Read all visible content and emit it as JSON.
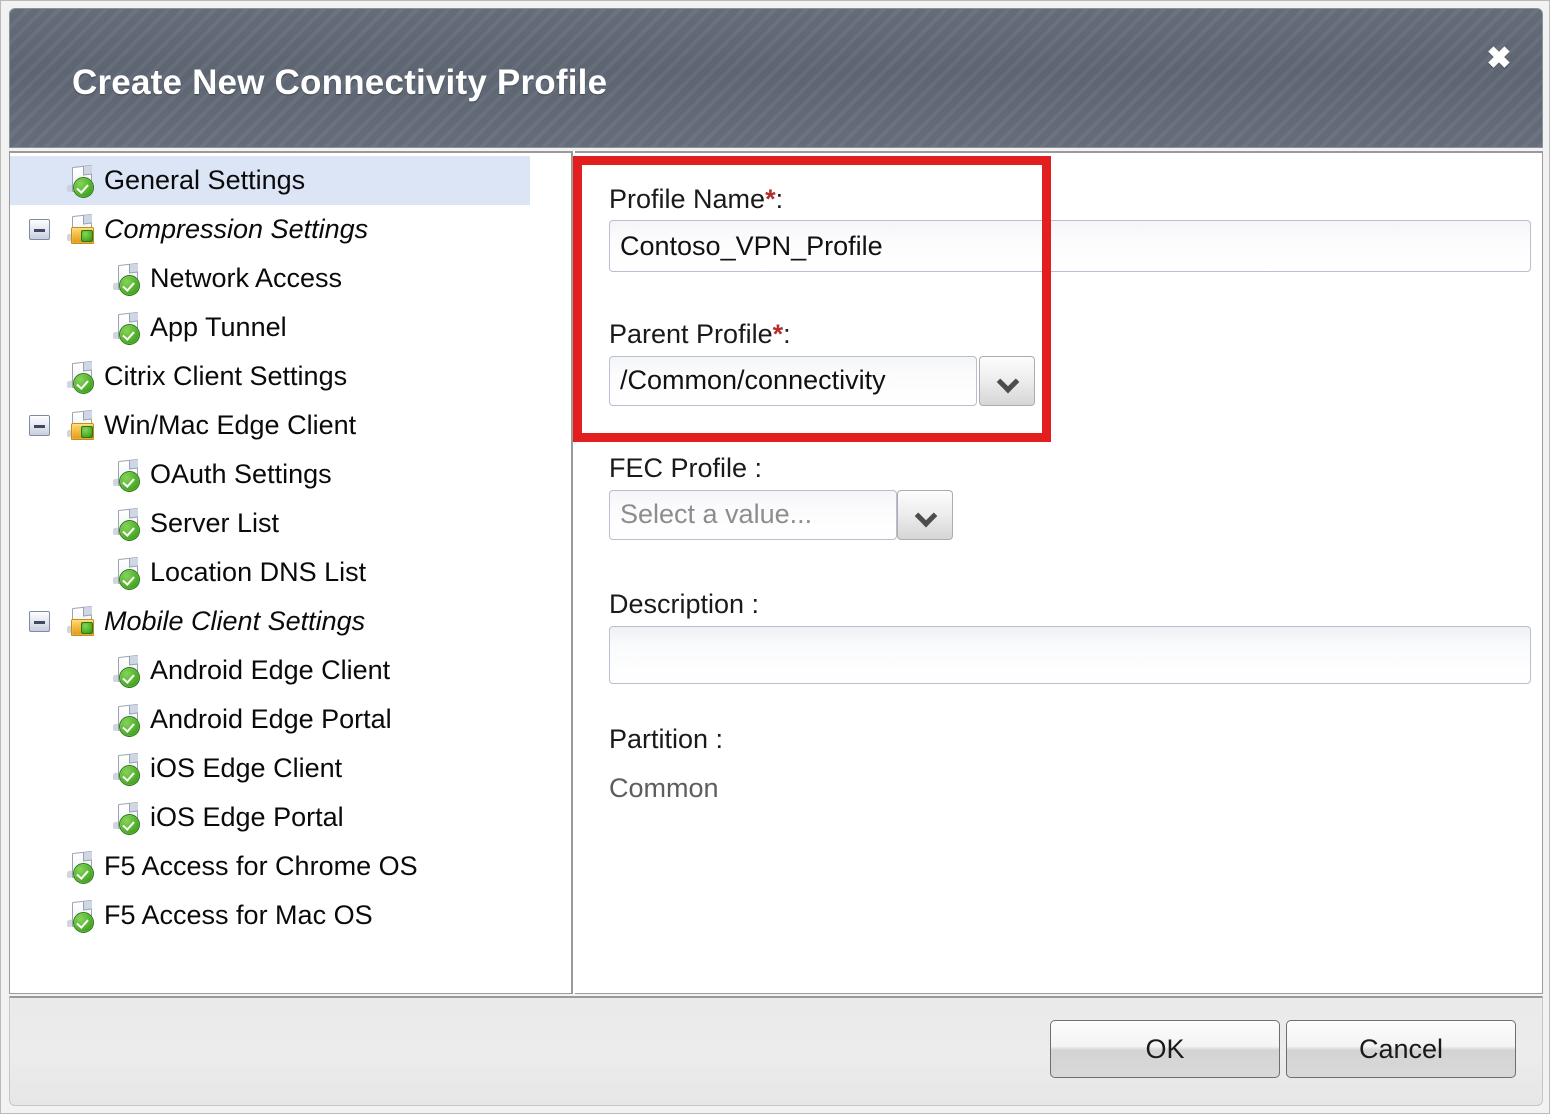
{
  "dialog": {
    "title": "Create New Connectivity Profile",
    "close_icon": "close-icon",
    "close_glyph": "✖"
  },
  "sidebar": {
    "items": [
      {
        "label": "General Settings",
        "indent": 0,
        "selected": true,
        "italic": false,
        "toggle": false,
        "icon": "page-check-icon"
      },
      {
        "label": "Compression Settings",
        "indent": 0,
        "selected": false,
        "italic": true,
        "toggle": true,
        "icon": "folder-check-icon"
      },
      {
        "label": "Network Access",
        "indent": 1,
        "selected": false,
        "italic": false,
        "toggle": false,
        "icon": "page-check-icon"
      },
      {
        "label": "App Tunnel",
        "indent": 1,
        "selected": false,
        "italic": false,
        "toggle": false,
        "icon": "page-check-icon"
      },
      {
        "label": "Citrix Client Settings",
        "indent": 0,
        "selected": false,
        "italic": false,
        "toggle": false,
        "icon": "page-check-icon"
      },
      {
        "label": "Win/Mac Edge Client",
        "indent": 0,
        "selected": false,
        "italic": false,
        "toggle": true,
        "icon": "folder-check-icon"
      },
      {
        "label": "OAuth Settings",
        "indent": 1,
        "selected": false,
        "italic": false,
        "toggle": false,
        "icon": "page-check-icon"
      },
      {
        "label": "Server List",
        "indent": 1,
        "selected": false,
        "italic": false,
        "toggle": false,
        "icon": "page-check-icon"
      },
      {
        "label": "Location DNS List",
        "indent": 1,
        "selected": false,
        "italic": false,
        "toggle": false,
        "icon": "page-check-icon"
      },
      {
        "label": "Mobile Client Settings",
        "indent": 0,
        "selected": false,
        "italic": true,
        "toggle": true,
        "icon": "folder-check-icon"
      },
      {
        "label": "Android Edge Client",
        "indent": 1,
        "selected": false,
        "italic": false,
        "toggle": false,
        "icon": "page-check-icon"
      },
      {
        "label": "Android Edge Portal",
        "indent": 1,
        "selected": false,
        "italic": false,
        "toggle": false,
        "icon": "page-check-icon"
      },
      {
        "label": "iOS Edge Client",
        "indent": 1,
        "selected": false,
        "italic": false,
        "toggle": false,
        "icon": "page-check-icon"
      },
      {
        "label": "iOS Edge Portal",
        "indent": 1,
        "selected": false,
        "italic": false,
        "toggle": false,
        "icon": "page-check-icon"
      },
      {
        "label": "F5 Access for Chrome OS",
        "indent": 0,
        "selected": false,
        "italic": false,
        "toggle": false,
        "icon": "page-check-icon"
      },
      {
        "label": "F5 Access for Mac OS",
        "indent": 0,
        "selected": false,
        "italic": false,
        "toggle": false,
        "icon": "page-check-icon"
      }
    ]
  },
  "form": {
    "profile_name": {
      "label": "Profile Name",
      "required_marker": "*",
      "colon": ":",
      "value": "Contoso_VPN_Profile",
      "placeholder": ""
    },
    "parent_profile": {
      "label": "Parent Profile",
      "required_marker": "*",
      "colon": ":",
      "value": "/Common/connectivity",
      "dropdown_icon": "chevron-down-icon"
    },
    "fec_profile": {
      "label": "FEC Profile :",
      "value": "Select a value...",
      "is_placeholder": true,
      "dropdown_icon": "chevron-down-icon"
    },
    "description": {
      "label": "Description :",
      "value": "",
      "placeholder": ""
    },
    "partition": {
      "label": "Partition :",
      "value": "Common"
    }
  },
  "footer": {
    "ok_label": "OK",
    "cancel_label": "Cancel"
  },
  "annotation": {
    "color": "#e31e1e"
  }
}
